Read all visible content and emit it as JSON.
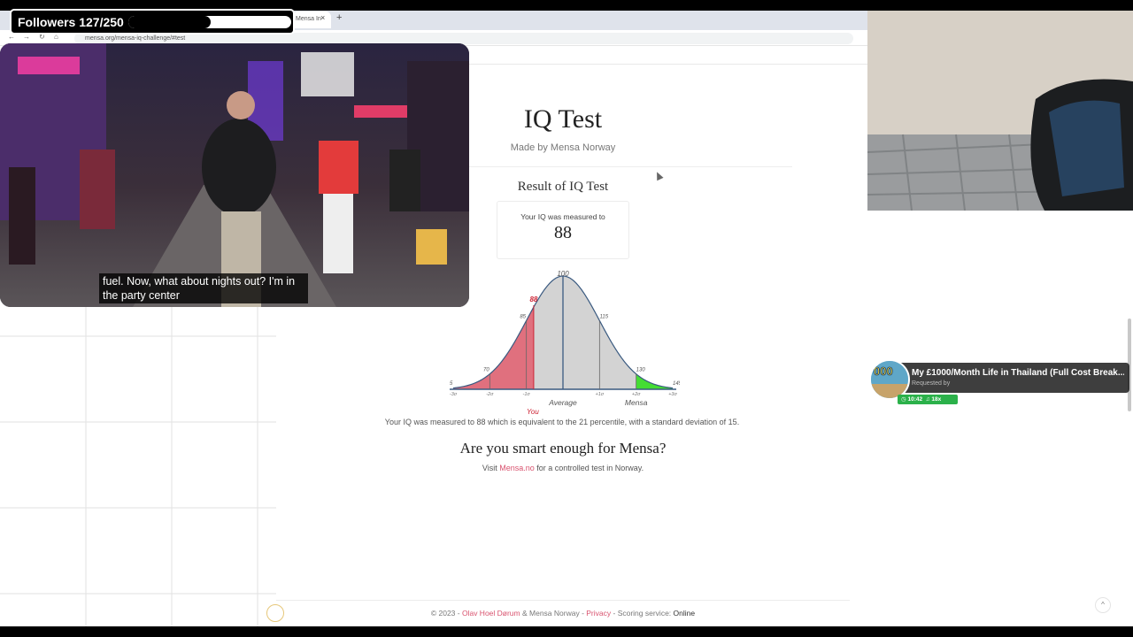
{
  "overlay": {
    "followers_label": "Followers 127/250",
    "followers_current": 127,
    "followers_goal": 250,
    "caption": "fuel. Now, what about nights out? I'm in the party center"
  },
  "browser": {
    "tab_label": "Mensa In",
    "tab_close": "×",
    "new_tab": "+",
    "url": "mensa.org/mensa-iq-challenge/#test",
    "back": "←",
    "forward": "→",
    "reload": "↻",
    "home": "⌂"
  },
  "page": {
    "title": "IQ Test",
    "subtitle": "Made by Mensa Norway",
    "result_heading": "Result of IQ Test",
    "result_caption": "Your IQ was measured to",
    "result_value": "88",
    "summary": "Your IQ was measured to 88 which is equivalent to the 21 percentile, with a standard deviation of 15.",
    "smart_heading": "Are you smart enough for Mensa?",
    "visit_prefix": "Visit ",
    "visit_link": "Mensa.no",
    "visit_suffix": " for a controlled test in Norway."
  },
  "chart_data": {
    "type": "area",
    "distribution": "normal",
    "mean": 100,
    "sd": 15,
    "xlim": [
      55,
      145
    ],
    "iq_tick_labels": [
      "55",
      "70",
      "85",
      "100",
      "115",
      "130",
      "145"
    ],
    "sd_tick_labels": [
      "-3σ",
      "-2σ",
      "-1σ",
      "",
      "+1σ",
      "+2σ",
      "+3σ"
    ],
    "marker_value": 88,
    "marker_label": "88",
    "mensa_threshold": 130,
    "labels": {
      "you": "You",
      "average": "Average",
      "mensa": "Mensa"
    },
    "colors": {
      "below": "#e0707e",
      "middle": "#d3d3d3",
      "mensa": "#44dd33",
      "line": "#3a5a80",
      "marker": "#cc2233"
    }
  },
  "footer": {
    "copyright": "© 2023 - ",
    "author": "Olav Hoel Dørum",
    "and": " & Mensa Norway - ",
    "privacy": "Privacy",
    "scoring": " - Scoring service: ",
    "status": "Online"
  },
  "music": {
    "title": "My £1000/Month Life in Thailand (Full Cost Break...",
    "requested": "Requested by",
    "time": "10:42",
    "count": "18x",
    "art_text": "000"
  },
  "scroll_up": "^"
}
